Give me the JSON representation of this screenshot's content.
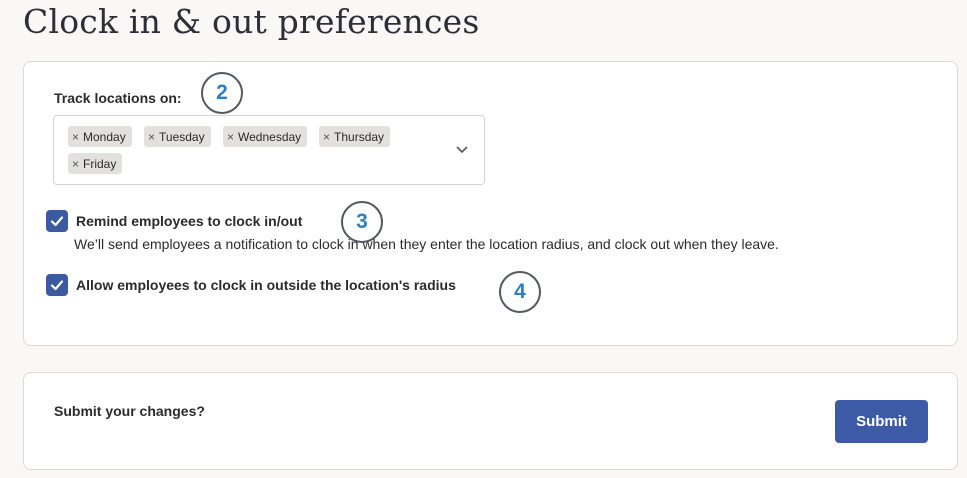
{
  "page": {
    "title": "Clock in & out preferences"
  },
  "track_locations": {
    "label": "Track locations on:",
    "selected_days": [
      "Monday",
      "Tuesday",
      "Wednesday",
      "Thursday",
      "Friday"
    ]
  },
  "remind": {
    "label": "Remind employees to clock in/out",
    "description": "We’ll send employees a notification to clock in when they enter the location radius, and clock out when they leave.",
    "checked": true
  },
  "allow_outside": {
    "label": "Allow employees to clock in outside the location's radius",
    "checked": true
  },
  "badges": {
    "b2": "2",
    "b3": "3",
    "b4": "4"
  },
  "submit": {
    "prompt": "Submit your changes?",
    "button_label": "Submit"
  },
  "colors": {
    "accent": "#3c5aa6",
    "badge_text": "#2f7fc1"
  },
  "icons": {
    "chip_remove": "close-icon",
    "dropdown": "chevron-down-icon",
    "checkbox": "checkmark-icon"
  }
}
